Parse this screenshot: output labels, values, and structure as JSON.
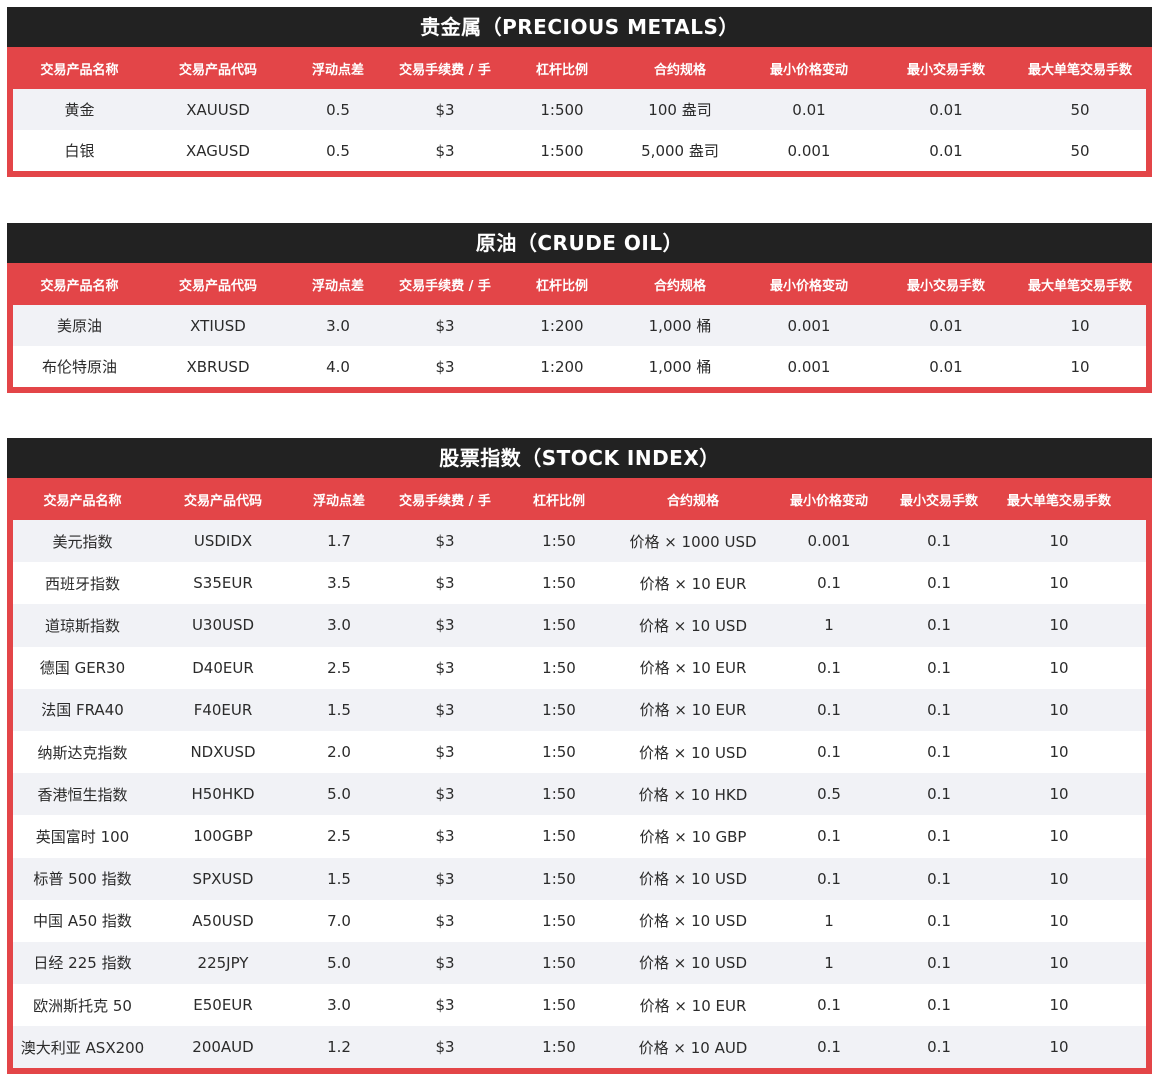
{
  "sections": [
    {
      "title": "贵金属（PRECIOUS METALS）",
      "headers": [
        "交易产品名称",
        "交易产品代码",
        "浮动点差",
        "交易手续费 / 手",
        "杠杆比例",
        "合约规格",
        "最小价格变动",
        "最小交易手数",
        "最大单笔交易手数"
      ],
      "rows": [
        [
          "黄金",
          "XAUUSD",
          "0.5",
          "$3",
          "1:500",
          "100 盎司",
          "0.01",
          "0.01",
          "50"
        ],
        [
          "白银",
          "XAGUSD",
          "0.5",
          "$3",
          "1:500",
          "5,000 盎司",
          "0.001",
          "0.01",
          "50"
        ]
      ]
    },
    {
      "title": "原油（CRUDE OIL）",
      "headers": [
        "交易产品名称",
        "交易产品代码",
        "浮动点差",
        "交易手续费 / 手",
        "杠杆比例",
        "合约规格",
        "最小价格变动",
        "最小交易手数",
        "最大单笔交易手数"
      ],
      "rows": [
        [
          "美原油",
          "XTIUSD",
          "3.0",
          "$3",
          "1:200",
          "1,000 桶",
          "0.001",
          "0.01",
          "10"
        ],
        [
          "布伦特原油",
          "XBRUSD",
          "4.0",
          "$3",
          "1:200",
          "1,000 桶",
          "0.001",
          "0.01",
          "10"
        ]
      ]
    },
    {
      "title": "股票指数（STOCK INDEX）",
      "headers": [
        "交易产品名称",
        "交易产品代码",
        "浮动点差",
        "交易手续费 / 手",
        "杠杆比例",
        "合约规格",
        "最小价格变动",
        "最小交易手数",
        "最大单笔交易手数"
      ],
      "rows": [
        [
          "美元指数",
          "USDIDX",
          "1.7",
          "$3",
          "1:50",
          "价格 × 1000 USD",
          "0.001",
          "0.1",
          "10"
        ],
        [
          "西班牙指数",
          "S35EUR",
          "3.5",
          "$3",
          "1:50",
          "价格 × 10 EUR",
          "0.1",
          "0.1",
          "10"
        ],
        [
          "道琼斯指数",
          "U30USD",
          "3.0",
          "$3",
          "1:50",
          "价格 × 10 USD",
          "1",
          "0.1",
          "10"
        ],
        [
          "德国 GER30",
          "D40EUR",
          "2.5",
          "$3",
          "1:50",
          "价格 × 10 EUR",
          "0.1",
          "0.1",
          "10"
        ],
        [
          "法国 FRA40",
          "F40EUR",
          "1.5",
          "$3",
          "1:50",
          "价格 × 10 EUR",
          "0.1",
          "0.1",
          "10"
        ],
        [
          "纳斯达克指数",
          "NDXUSD",
          "2.0",
          "$3",
          "1:50",
          "价格 × 10 USD",
          "0.1",
          "0.1",
          "10"
        ],
        [
          "香港恒生指数",
          "H50HKD",
          "5.0",
          "$3",
          "1:50",
          "价格 × 10 HKD",
          "0.5",
          "0.1",
          "10"
        ],
        [
          "英国富时 100",
          "100GBP",
          "2.5",
          "$3",
          "1:50",
          "价格 × 10 GBP",
          "0.1",
          "0.1",
          "10"
        ],
        [
          "标普 500 指数",
          "SPXUSD",
          "1.5",
          "$3",
          "1:50",
          "价格 × 10 USD",
          "0.1",
          "0.1",
          "10"
        ],
        [
          "中国 A50 指数",
          "A50USD",
          "7.0",
          "$3",
          "1:50",
          "价格 × 10 USD",
          "1",
          "0.1",
          "10"
        ],
        [
          "日经 225 指数",
          "225JPY",
          "5.0",
          "$3",
          "1:50",
          "价格 × 10 USD",
          "1",
          "0.1",
          "10"
        ],
        [
          "欧洲斯托克 50",
          "E50EUR",
          "3.0",
          "$3",
          "1:50",
          "价格 × 10 EUR",
          "0.1",
          "0.1",
          "10"
        ],
        [
          "澳大利亚 ASX200",
          "200AUD",
          "1.2",
          "$3",
          "1:50",
          "价格 × 10 AUD",
          "0.1",
          "0.1",
          "10"
        ]
      ]
    }
  ],
  "colors": {
    "title_bar": "#222222",
    "header_red": "#e34548",
    "row_alt": "#f1f2f6",
    "text": "#2b2b2b"
  }
}
